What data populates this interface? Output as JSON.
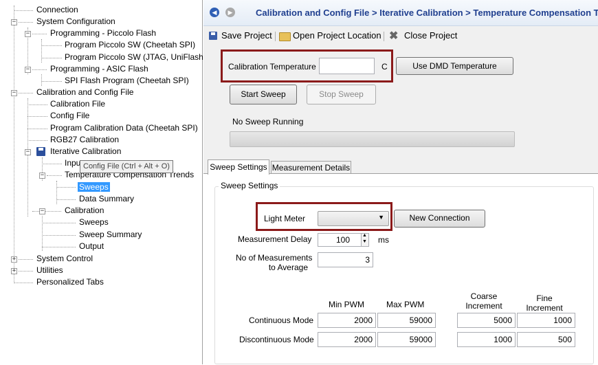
{
  "tree": {
    "items": [
      {
        "label": "Connection"
      },
      {
        "label": "System Configuration"
      },
      {
        "label": "Programming - Piccolo Flash"
      },
      {
        "label": "Program Piccolo SW (Cheetah SPI)"
      },
      {
        "label": "Program Piccolo SW (JTAG, UniFlash)"
      },
      {
        "label": "Programming - ASIC Flash"
      },
      {
        "label": "SPI Flash Program (Cheetah SPI)"
      },
      {
        "label": "Calibration and Config File"
      },
      {
        "label": "Calibration File"
      },
      {
        "label": "Config File"
      },
      {
        "label": "Program Calibration Data (Cheetah SPI)"
      },
      {
        "label": "RGB27 Calibration"
      },
      {
        "label": "Iterative Calibration"
      },
      {
        "label": "Inpu"
      },
      {
        "label": "Temperature Compensation Trends"
      },
      {
        "label": "Sweeps"
      },
      {
        "label": "Data Summary"
      },
      {
        "label": "Calibration"
      },
      {
        "label": "Sweeps"
      },
      {
        "label": "Sweep Summary"
      },
      {
        "label": "Output"
      },
      {
        "label": "System Control"
      },
      {
        "label": "Utilities"
      },
      {
        "label": "Personalized Tabs"
      }
    ],
    "tooltip": "Config File (Ctrl + Alt + O)"
  },
  "header": {
    "breadcrumb": "Calibration and Config File > Iterative Calibration > Temperature Compensation Tr"
  },
  "toolbar": {
    "save": "Save Project",
    "open": "Open Project Location",
    "close": "Close Project"
  },
  "calibration": {
    "temp_label": "Calibration Temperature",
    "temp_value": "",
    "temp_unit": "C",
    "use_dmd": "Use DMD Temperature",
    "start": "Start Sweep",
    "stop": "Stop Sweep",
    "status": "No Sweep Running"
  },
  "tabs": [
    "Sweep Settings",
    "Measurement Details"
  ],
  "sweep": {
    "group_title": "Sweep Settings",
    "light_meter_label": "Light Meter",
    "light_meter_value": "",
    "new_connection": "New Connection",
    "delay_label": "Measurement Delay",
    "delay_value": "100",
    "delay_unit": "ms",
    "avg_label_1": "No of Measurements",
    "avg_label_2": "to Average",
    "avg_value": "3",
    "headers": {
      "min": "Min PWM",
      "max": "Max PWM",
      "coarse_1": "Coarse",
      "coarse_2": "Increment",
      "fine_1": "Fine",
      "fine_2": "Increment"
    },
    "rows": [
      {
        "label": "Continuous Mode",
        "min": "2000",
        "max": "59000",
        "coarse": "5000",
        "fine": "1000"
      },
      {
        "label": "Discontinuous Mode",
        "min": "2000",
        "max": "59000",
        "coarse": "1000",
        "fine": "500"
      }
    ]
  }
}
